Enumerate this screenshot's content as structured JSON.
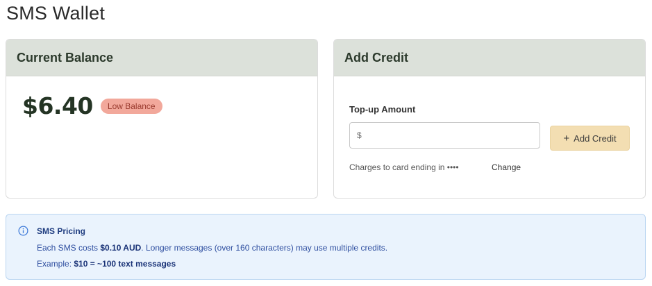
{
  "page": {
    "title": "SMS Wallet"
  },
  "balance_card": {
    "header": "Current Balance",
    "amount": "$6.40",
    "badge": "Low Balance"
  },
  "credit_card": {
    "header": "Add Credit",
    "topup_label": "Top-up Amount",
    "topup_placeholder": "$",
    "button_label": "Add Credit",
    "button_icon": "plus-icon",
    "charges_text": "Charges to card ending in ••••",
    "change_label": "Change"
  },
  "pricing_info": {
    "icon": "info-icon",
    "title": "SMS Pricing",
    "line1_prefix": "Each SMS costs ",
    "line1_price": "$0.10 AUD",
    "line1_suffix": ". Longer messages (over 160 characters) may use multiple credits.",
    "line2_prefix": "Example: ",
    "line2_example": "$10 = ~100 text messages"
  },
  "colors": {
    "card_header_bg": "#dce1da",
    "badge_bg": "#f2a89b",
    "button_bg": "#f3deb2",
    "info_bg": "#eaf3fd",
    "info_text": "#2f4fa0"
  }
}
